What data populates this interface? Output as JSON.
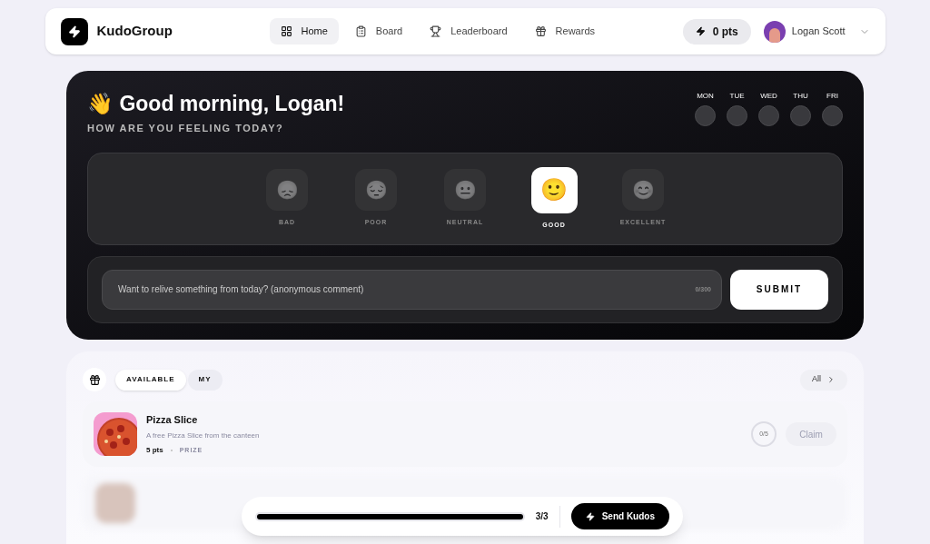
{
  "brand": "KudoGroup",
  "nav": [
    {
      "label": "Home",
      "selected": true
    },
    {
      "label": "Board",
      "selected": false
    },
    {
      "label": "Leaderboard",
      "selected": false
    },
    {
      "label": "Rewards",
      "selected": false
    }
  ],
  "points": "0 pts",
  "user": "Logan Scott",
  "greeting": "👋 Good morning, Logan!",
  "subtitle": "HOW ARE YOU FEELING TODAY?",
  "days": [
    "MON",
    "TUE",
    "WED",
    "THU",
    "FRI"
  ],
  "moods": [
    {
      "label": "BAD",
      "emoji": "😞",
      "selected": false
    },
    {
      "label": "POOR",
      "emoji": "😔",
      "selected": false
    },
    {
      "label": "NEUTRAL",
      "emoji": "😐",
      "selected": false
    },
    {
      "label": "GOOD",
      "emoji": "🙂",
      "selected": true
    },
    {
      "label": "EXCELLENT",
      "emoji": "😊",
      "selected": false
    }
  ],
  "comment": {
    "placeholder": "Want to relive something from today? (anonymous comment)",
    "counter": "0/300"
  },
  "submit": "SUBMIT",
  "reward_tabs": [
    {
      "label": "AVAILABLE",
      "selected": true
    },
    {
      "label": "MY",
      "selected": false
    }
  ],
  "all_link": "All",
  "rewards": [
    {
      "title": "Pizza Slice",
      "description": "A free Pizza Slice from the canteen",
      "points": "5 pts",
      "type": "PRIZE",
      "claimed": "0/5",
      "action": "Claim",
      "disabled": true
    }
  ],
  "kudos": {
    "level": 1,
    "count": "3/3",
    "button": "Send Kudos"
  }
}
